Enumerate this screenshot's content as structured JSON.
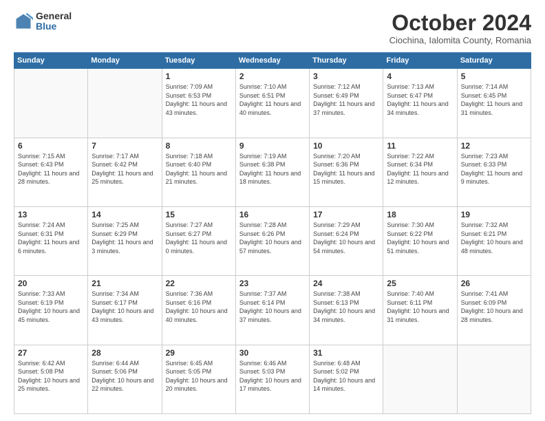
{
  "header": {
    "logo_general": "General",
    "logo_blue": "Blue",
    "month_title": "October 2024",
    "subtitle": "Ciochina, Ialomita County, Romania"
  },
  "days_of_week": [
    "Sunday",
    "Monday",
    "Tuesday",
    "Wednesday",
    "Thursday",
    "Friday",
    "Saturday"
  ],
  "weeks": [
    [
      {
        "day": "",
        "info": ""
      },
      {
        "day": "",
        "info": ""
      },
      {
        "day": "1",
        "info": "Sunrise: 7:09 AM\nSunset: 6:53 PM\nDaylight: 11 hours and 43 minutes."
      },
      {
        "day": "2",
        "info": "Sunrise: 7:10 AM\nSunset: 6:51 PM\nDaylight: 11 hours and 40 minutes."
      },
      {
        "day": "3",
        "info": "Sunrise: 7:12 AM\nSunset: 6:49 PM\nDaylight: 11 hours and 37 minutes."
      },
      {
        "day": "4",
        "info": "Sunrise: 7:13 AM\nSunset: 6:47 PM\nDaylight: 11 hours and 34 minutes."
      },
      {
        "day": "5",
        "info": "Sunrise: 7:14 AM\nSunset: 6:45 PM\nDaylight: 11 hours and 31 minutes."
      }
    ],
    [
      {
        "day": "6",
        "info": "Sunrise: 7:15 AM\nSunset: 6:43 PM\nDaylight: 11 hours and 28 minutes."
      },
      {
        "day": "7",
        "info": "Sunrise: 7:17 AM\nSunset: 6:42 PM\nDaylight: 11 hours and 25 minutes."
      },
      {
        "day": "8",
        "info": "Sunrise: 7:18 AM\nSunset: 6:40 PM\nDaylight: 11 hours and 21 minutes."
      },
      {
        "day": "9",
        "info": "Sunrise: 7:19 AM\nSunset: 6:38 PM\nDaylight: 11 hours and 18 minutes."
      },
      {
        "day": "10",
        "info": "Sunrise: 7:20 AM\nSunset: 6:36 PM\nDaylight: 11 hours and 15 minutes."
      },
      {
        "day": "11",
        "info": "Sunrise: 7:22 AM\nSunset: 6:34 PM\nDaylight: 11 hours and 12 minutes."
      },
      {
        "day": "12",
        "info": "Sunrise: 7:23 AM\nSunset: 6:33 PM\nDaylight: 11 hours and 9 minutes."
      }
    ],
    [
      {
        "day": "13",
        "info": "Sunrise: 7:24 AM\nSunset: 6:31 PM\nDaylight: 11 hours and 6 minutes."
      },
      {
        "day": "14",
        "info": "Sunrise: 7:25 AM\nSunset: 6:29 PM\nDaylight: 11 hours and 3 minutes."
      },
      {
        "day": "15",
        "info": "Sunrise: 7:27 AM\nSunset: 6:27 PM\nDaylight: 11 hours and 0 minutes."
      },
      {
        "day": "16",
        "info": "Sunrise: 7:28 AM\nSunset: 6:26 PM\nDaylight: 10 hours and 57 minutes."
      },
      {
        "day": "17",
        "info": "Sunrise: 7:29 AM\nSunset: 6:24 PM\nDaylight: 10 hours and 54 minutes."
      },
      {
        "day": "18",
        "info": "Sunrise: 7:30 AM\nSunset: 6:22 PM\nDaylight: 10 hours and 51 minutes."
      },
      {
        "day": "19",
        "info": "Sunrise: 7:32 AM\nSunset: 6:21 PM\nDaylight: 10 hours and 48 minutes."
      }
    ],
    [
      {
        "day": "20",
        "info": "Sunrise: 7:33 AM\nSunset: 6:19 PM\nDaylight: 10 hours and 45 minutes."
      },
      {
        "day": "21",
        "info": "Sunrise: 7:34 AM\nSunset: 6:17 PM\nDaylight: 10 hours and 43 minutes."
      },
      {
        "day": "22",
        "info": "Sunrise: 7:36 AM\nSunset: 6:16 PM\nDaylight: 10 hours and 40 minutes."
      },
      {
        "day": "23",
        "info": "Sunrise: 7:37 AM\nSunset: 6:14 PM\nDaylight: 10 hours and 37 minutes."
      },
      {
        "day": "24",
        "info": "Sunrise: 7:38 AM\nSunset: 6:13 PM\nDaylight: 10 hours and 34 minutes."
      },
      {
        "day": "25",
        "info": "Sunrise: 7:40 AM\nSunset: 6:11 PM\nDaylight: 10 hours and 31 minutes."
      },
      {
        "day": "26",
        "info": "Sunrise: 7:41 AM\nSunset: 6:09 PM\nDaylight: 10 hours and 28 minutes."
      }
    ],
    [
      {
        "day": "27",
        "info": "Sunrise: 6:42 AM\nSunset: 5:08 PM\nDaylight: 10 hours and 25 minutes."
      },
      {
        "day": "28",
        "info": "Sunrise: 6:44 AM\nSunset: 5:06 PM\nDaylight: 10 hours and 22 minutes."
      },
      {
        "day": "29",
        "info": "Sunrise: 6:45 AM\nSunset: 5:05 PM\nDaylight: 10 hours and 20 minutes."
      },
      {
        "day": "30",
        "info": "Sunrise: 6:46 AM\nSunset: 5:03 PM\nDaylight: 10 hours and 17 minutes."
      },
      {
        "day": "31",
        "info": "Sunrise: 6:48 AM\nSunset: 5:02 PM\nDaylight: 10 hours and 14 minutes."
      },
      {
        "day": "",
        "info": ""
      },
      {
        "day": "",
        "info": ""
      }
    ]
  ]
}
